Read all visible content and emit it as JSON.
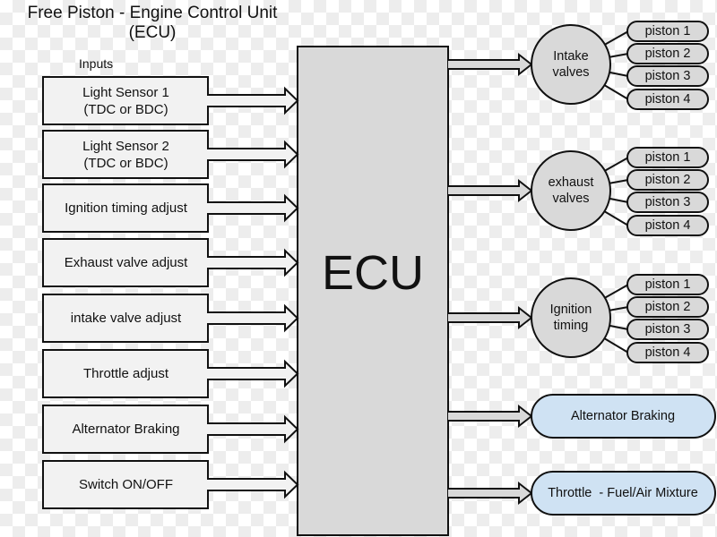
{
  "title": {
    "line1": "Free Piston - Engine Control Unit",
    "line2": "(ECU)"
  },
  "inputs_label": "Inputs",
  "inputs": [
    {
      "label": "Light Sensor 1\n(TDC or BDC)"
    },
    {
      "label": "Light Sensor 2\n(TDC or BDC)"
    },
    {
      "label": "Ignition timing adjust"
    },
    {
      "label": "Exhaust valve adjust"
    },
    {
      "label": "intake valve adjust"
    },
    {
      "label": "Throttle adjust"
    },
    {
      "label": "Alternator Braking"
    },
    {
      "label": "Switch ON/OFF"
    }
  ],
  "ecu": {
    "label": "ECU"
  },
  "outputs_grouped": [
    {
      "label": "Intake\nvalves",
      "pistons": [
        "piston 1",
        "piston 2",
        "piston 3",
        "piston 4"
      ]
    },
    {
      "label": "exhaust\nvalves",
      "pistons": [
        "piston 1",
        "piston 2",
        "piston 3",
        "piston 4"
      ]
    },
    {
      "label": "Ignition\ntiming",
      "pistons": [
        "piston 1",
        "piston 2",
        "piston 3",
        "piston 4"
      ]
    }
  ],
  "outputs_single": [
    {
      "label": "Alternator Braking"
    },
    {
      "label": "Throttle  - Fuel/Air Mixture"
    }
  ],
  "colors": {
    "input_fill": "#f2f2f2",
    "ecu_fill": "#d9d9d9",
    "node_fill": "#d9d9d9",
    "output_fill": "#cfe2f3",
    "stroke": "#111111"
  }
}
